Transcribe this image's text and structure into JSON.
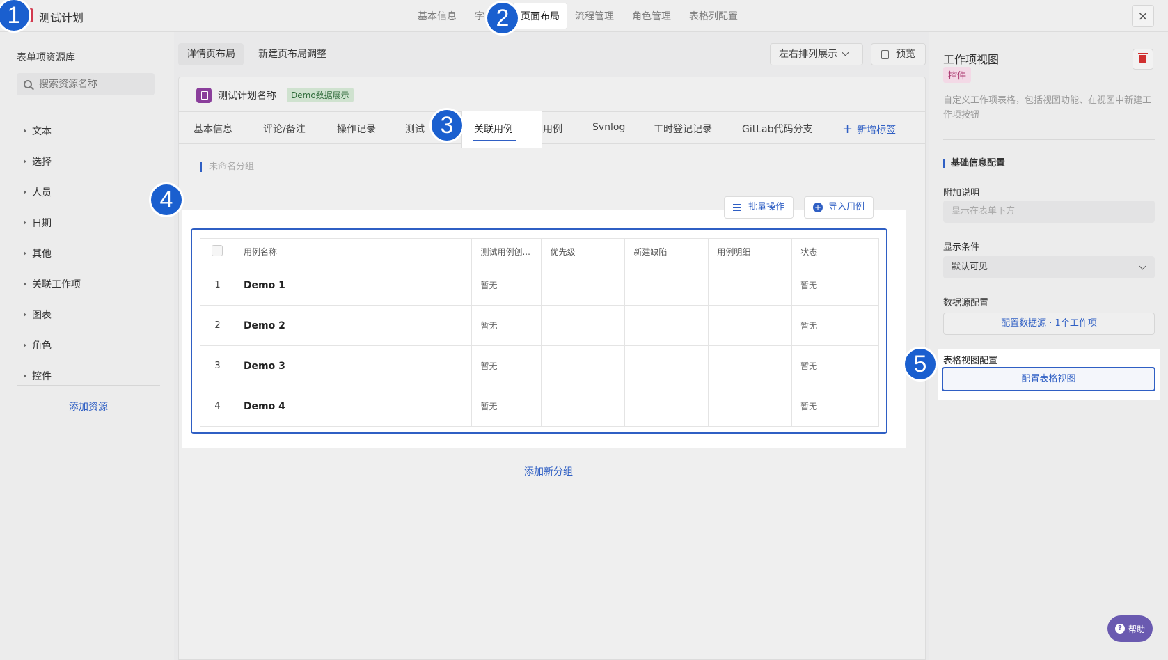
{
  "topbar": {
    "title": "测试计划",
    "tabs": [
      {
        "label": "基本信息"
      },
      {
        "label": "字"
      },
      {
        "label": "页面布局"
      },
      {
        "label": "流程管理"
      },
      {
        "label": "角色管理"
      },
      {
        "label": "表格列配置"
      }
    ],
    "close": "×"
  },
  "left": {
    "title": "表单项资源库",
    "search_placeholder": "搜索资源名称",
    "items": [
      "文本",
      "选择",
      "人员",
      "日期",
      "其他",
      "关联工作项",
      "图表",
      "角色",
      "控件"
    ],
    "add_resource": "添加资源"
  },
  "center": {
    "segments": [
      "详情页布局",
      "新建页布局调整"
    ],
    "layout_select": "左右排列展示",
    "preview": "预览",
    "plan_name": "测试计划名称",
    "demo_badge": "Demo数据展示",
    "tabs": [
      "基本信息",
      "评论/备注",
      "操作记录",
      "测试",
      "关联用例",
      "用例",
      "Svnlog",
      "工时登记记录",
      "GitLab代码分支",
      "新增标签"
    ],
    "group_title": "未命名分组",
    "batch_action": "批量操作",
    "import_cases": "导入用例",
    "add_group": "添加新分组",
    "table": {
      "headers": [
        "用例名称",
        "测试用例创...",
        "优先级",
        "新建缺陷",
        "用例明细",
        "状态"
      ],
      "rows": [
        {
          "idx": "1",
          "name": "Demo 1",
          "creator": "暂无",
          "priority": "",
          "defect": "",
          "detail": "",
          "status": "暂无"
        },
        {
          "idx": "2",
          "name": "Demo 2",
          "creator": "暂无",
          "priority": "",
          "defect": "",
          "detail": "",
          "status": "暂无"
        },
        {
          "idx": "3",
          "name": "Demo 3",
          "creator": "暂无",
          "priority": "",
          "defect": "",
          "detail": "",
          "status": "暂无"
        },
        {
          "idx": "4",
          "name": "Demo 4",
          "creator": "暂无",
          "priority": "",
          "defect": "",
          "detail": "",
          "status": "暂无"
        }
      ]
    }
  },
  "right": {
    "title": "工作项视图",
    "tag": "控件",
    "description": "自定义工作项表格，包括视图功能、在视图中新建工作项按钮",
    "section": "基础信息配置",
    "extra_label": "附加说明",
    "extra_placeholder": "显示在表单下方",
    "cond_label": "显示条件",
    "cond_value": "默认可见",
    "ds_label": "数据源配置",
    "ds_button": "配置数据源 · 1个工作项",
    "tv_label": "表格视图配置",
    "tv_button": "配置表格视图"
  },
  "help": "帮助",
  "markers": [
    "1",
    "2",
    "3",
    "4",
    "5"
  ],
  "colors": {
    "accent": "#2f5fc4",
    "marker": "#1a5fcf",
    "help": "#6a5ab0",
    "danger": "#d03030"
  }
}
